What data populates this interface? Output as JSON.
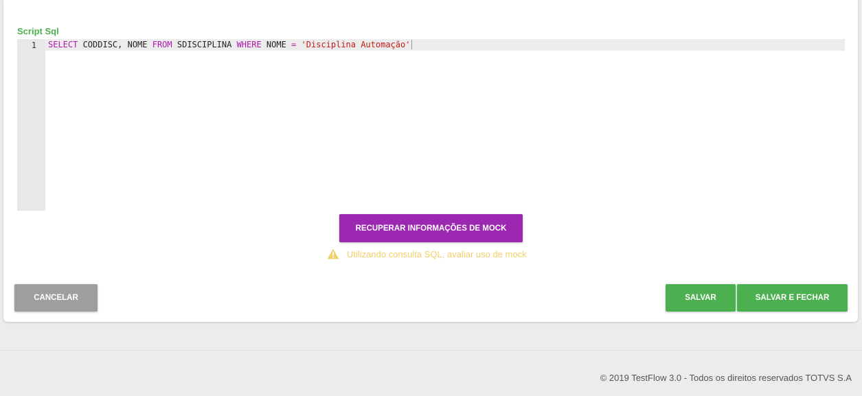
{
  "script_section": {
    "label": "Script Sql"
  },
  "editor": {
    "line_number": "1",
    "tokens": {
      "t1": "SELECT",
      "t2": " CODDISC, NOME ",
      "t3": "FROM",
      "t4": " SDISCIPLINA ",
      "t5": "WHERE",
      "t6": " NOME ",
      "t7": "=",
      "t8": " ",
      "t9": "'Disciplina Automação'"
    },
    "colors": {
      "keyword": "#b118b1",
      "string": "#c41a16",
      "gutter": "#e8e8e8",
      "active_line": "#ececec"
    }
  },
  "mock_button": {
    "label": "RECUPERAR INFORMAÇÕES DE MOCK",
    "color": "#9c27b0"
  },
  "warning": {
    "icon": "warning-triangle-icon",
    "text": "Utilizando consulta SQL, avaliar uso de mock",
    "color": "#f2cf6a"
  },
  "actions": {
    "cancel_label": "CANCELAR",
    "save_label": "SALVAR",
    "save_close_label": "SALVAR E FECHAR",
    "cancel_color": "#9e9e9e",
    "save_color": "#4caf50"
  },
  "footer": {
    "text": "© 2019 TestFlow 3.0 - Todos os direitos reservados TOTVS S.A"
  }
}
